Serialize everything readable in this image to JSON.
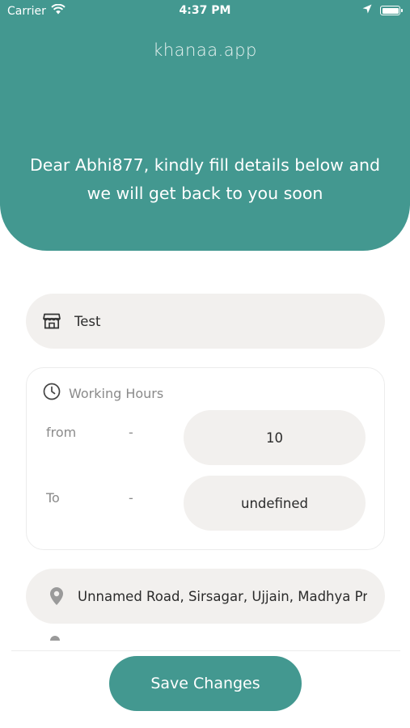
{
  "status_bar": {
    "carrier": "Carrier",
    "time": "4:37 PM"
  },
  "header": {
    "brand": "khanaa.app",
    "greeting": "Dear Abhi877, kindly fill details below and we will get back to you soon",
    "color": "#439890"
  },
  "form": {
    "store_name": {
      "value": "Test",
      "icon": "store-icon"
    },
    "working_hours": {
      "title": "Working Hours",
      "icon": "clock-icon",
      "from_label": "from",
      "from_dash": "-",
      "from_value": "10",
      "to_label": "To",
      "to_dash": "-",
      "to_value": "undefined"
    },
    "address": {
      "value": "Unnamed Road, Sirsagar, Ujjain, Madhya Pradesh",
      "icon": "location-pin-icon"
    }
  },
  "footer": {
    "save_label": "Save Changes"
  }
}
